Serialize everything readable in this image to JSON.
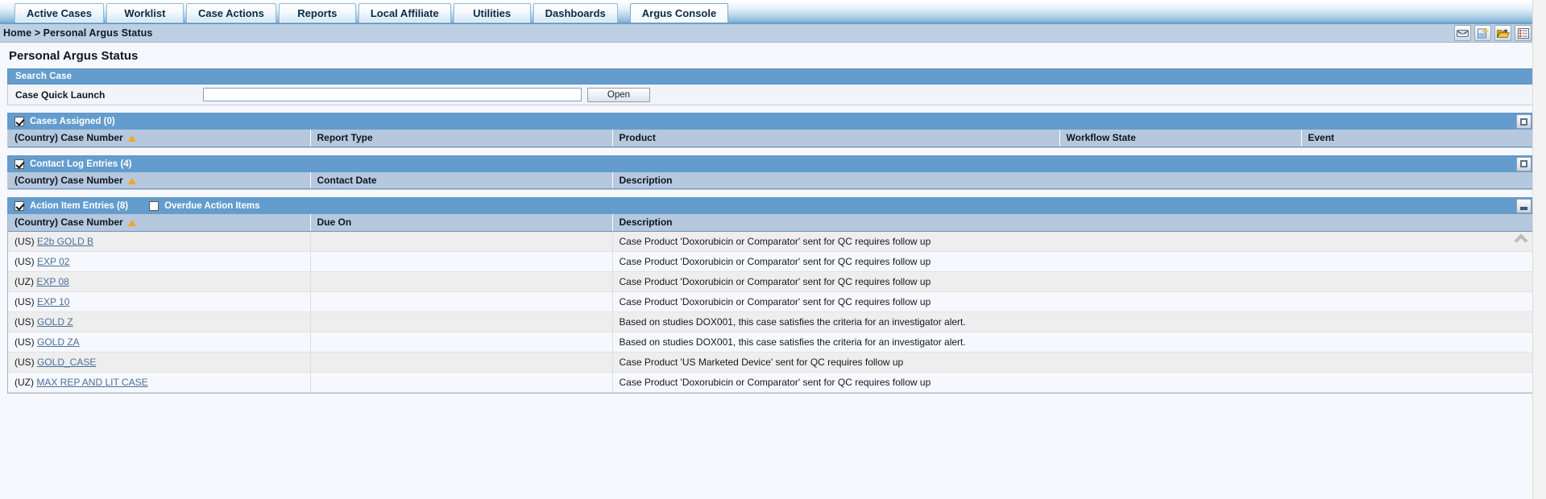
{
  "tabs": [
    {
      "label": "Active Cases",
      "active": false
    },
    {
      "label": "Worklist",
      "active": false
    },
    {
      "label": "Case Actions",
      "active": false
    },
    {
      "label": "Reports",
      "active": false
    },
    {
      "label": "Local Affiliate",
      "active": false
    },
    {
      "label": "Utilities",
      "active": false
    },
    {
      "label": "Dashboards",
      "active": false
    },
    {
      "label": "Argus Console",
      "active": true
    }
  ],
  "breadcrumb": "Home > Personal Argus Status",
  "toolbar_icons": [
    {
      "name": "mail-icon"
    },
    {
      "name": "new-page-icon"
    },
    {
      "name": "open-folder-icon"
    },
    {
      "name": "report-list-icon"
    }
  ],
  "page_title": "Personal Argus Status",
  "search": {
    "section_title": "Search Case",
    "field_label": "Case Quick Launch",
    "input_value": "",
    "input_placeholder": "",
    "open_button": "Open"
  },
  "cases_assigned": {
    "title": "Cases Assigned (0)",
    "checked": true,
    "window_button": "maximize",
    "columns": [
      "(Country) Case Number",
      "Report Type",
      "Product",
      "Workflow State",
      "Event"
    ],
    "rows": []
  },
  "contact_log": {
    "title": "Contact Log Entries (4)",
    "checked": true,
    "window_button": "maximize",
    "columns": [
      "(Country) Case Number",
      "Contact Date",
      "Description"
    ],
    "rows": []
  },
  "action_items": {
    "title": "Action Item Entries (8)",
    "checked": true,
    "overdue_label": "Overdue Action Items",
    "overdue_checked": false,
    "window_button": "minimize",
    "columns": [
      "(Country) Case Number",
      "Due On",
      "Description"
    ],
    "rows": [
      {
        "country": "(US)",
        "case_number": "E2b GOLD B",
        "due_on": "",
        "description": "Case Product 'Doxorubicin or Comparator' sent for QC requires follow up"
      },
      {
        "country": "(US)",
        "case_number": "EXP 02",
        "due_on": "",
        "description": "Case Product 'Doxorubicin or Comparator' sent for QC requires follow up"
      },
      {
        "country": "(UZ)",
        "case_number": "EXP 08",
        "due_on": "",
        "description": "Case Product 'Doxorubicin or Comparator' sent for QC requires follow up"
      },
      {
        "country": "(US)",
        "case_number": "EXP 10",
        "due_on": "",
        "description": "Case Product 'Doxorubicin or Comparator' sent for QC requires follow up"
      },
      {
        "country": "(US)",
        "case_number": "GOLD Z",
        "due_on": "",
        "description": "Based on studies DOX001, this case satisfies the criteria for an investigator alert."
      },
      {
        "country": "(US)",
        "case_number": "GOLD ZA",
        "due_on": "",
        "description": "Based on studies DOX001, this case satisfies the criteria for an investigator alert."
      },
      {
        "country": "(US)",
        "case_number": "GOLD_CASE",
        "due_on": "",
        "description": "Case Product 'US Marketed Device' sent for QC requires follow up"
      },
      {
        "country": "(UZ)",
        "case_number": "MAX REP AND LIT CASE",
        "due_on": "",
        "description": "Case Product 'Doxorubicin or Comparator' sent for QC requires follow up"
      }
    ]
  },
  "colors": {
    "header_blue": "#649ccd",
    "column_header_blue": "#b5c8dd",
    "breadcrumb_blue": "#bccfe3",
    "sort_arrow_orange": "#f5a623",
    "link_blue": "#4a6f9b",
    "row_odd": "#eeeeee",
    "row_even": "#f7f8fd"
  }
}
